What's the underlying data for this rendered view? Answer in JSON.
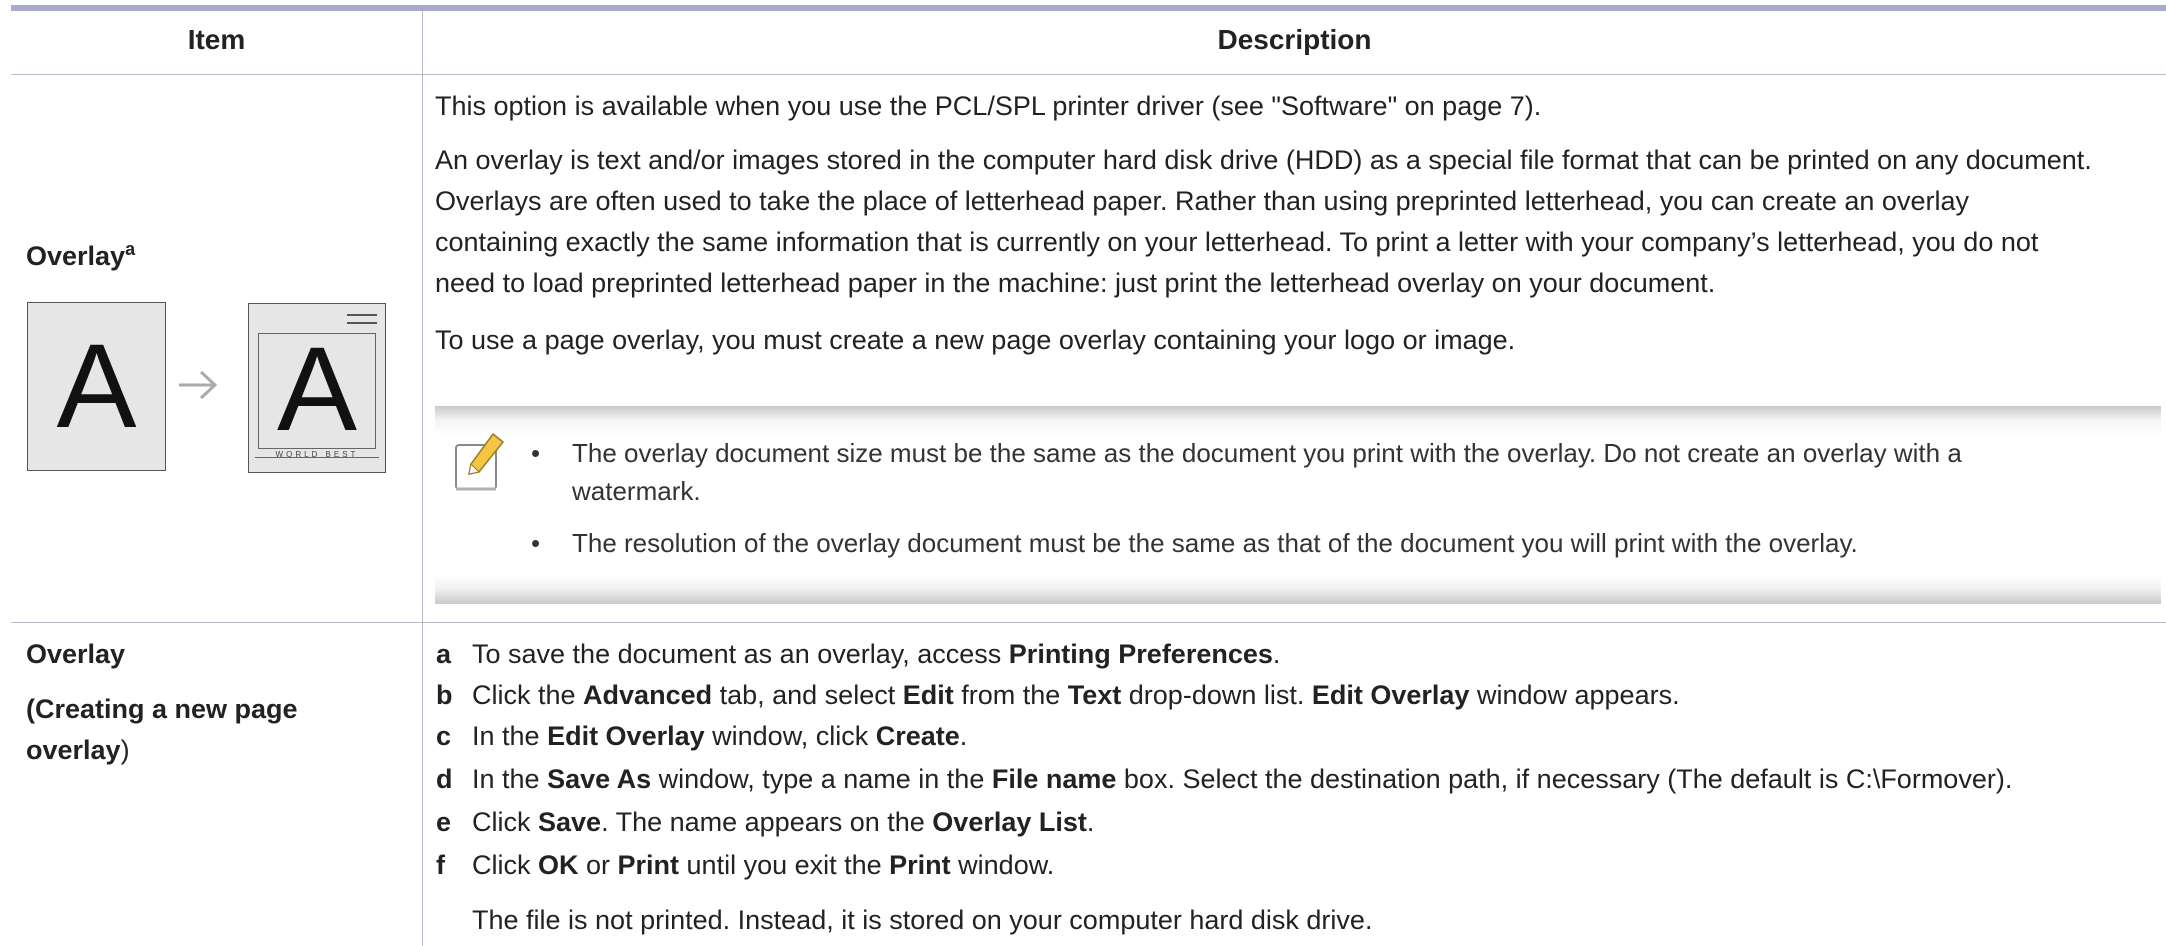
{
  "table": {
    "header": {
      "item": "Item",
      "description": "Description"
    },
    "row1": {
      "item_label": "Overlay",
      "item_sup": "a",
      "figure": {
        "left_letter": "A",
        "right_letter": "A",
        "footer_text": "WORLD BEST"
      },
      "para1": "This option is available when you use the PCL/SPL printer driver (see \"Software\" on page 7).",
      "para2_lines": [
        "An overlay is text and/or images stored in the computer hard disk drive (HDD) as a special file format that can be printed on any document.",
        "Overlays are often used to take the place of letterhead paper. Rather than using preprinted letterhead, you can create an overlay",
        "containing exactly the same information that is currently on your letterhead. To print a letter with your company’s letterhead, you do not",
        "need to load preprinted letterhead paper in the machine: just print the letterhead overlay on your document."
      ],
      "para3": "To use a page overlay, you must create a new page overlay containing your logo or image.",
      "note": {
        "icon": "note-pencil-icon",
        "bullets": [
          {
            "line1": "The overlay document size must be the same as the document you print with the overlay. Do not create an overlay with a",
            "line2": "watermark."
          },
          {
            "line1": "The resolution of the overlay document must be the same as that of the document you will print with the overlay.",
            "line2": ""
          }
        ]
      }
    },
    "row2": {
      "item_line1": "Overlay",
      "item_line2_bold": "(Creating a new page",
      "item_line3_bold": "overlay",
      "item_line3_tail": ")",
      "steps": [
        {
          "letter": "a",
          "parts": [
            {
              "t": "To save the document as an overlay, access ",
              "b": false
            },
            {
              "t": "Printing Preferences",
              "b": true
            },
            {
              "t": ".",
              "b": false
            }
          ]
        },
        {
          "letter": "b",
          "parts": [
            {
              "t": "Click the ",
              "b": false
            },
            {
              "t": "Advanced",
              "b": true
            },
            {
              "t": " tab, and select ",
              "b": false
            },
            {
              "t": "Edit",
              "b": true
            },
            {
              "t": " from the ",
              "b": false
            },
            {
              "t": "Text",
              "b": true
            },
            {
              "t": " drop-down list. ",
              "b": false
            },
            {
              "t": "Edit Overlay",
              "b": true
            },
            {
              "t": " window appears.",
              "b": false
            }
          ]
        },
        {
          "letter": "c",
          "parts": [
            {
              "t": "In the ",
              "b": false
            },
            {
              "t": "Edit Overlay",
              "b": true
            },
            {
              "t": " window, click ",
              "b": false
            },
            {
              "t": "Create",
              "b": true
            },
            {
              "t": ".",
              "b": false
            }
          ]
        },
        {
          "letter": "d",
          "parts": [
            {
              "t": "In the ",
              "b": false
            },
            {
              "t": "Save As",
              "b": true
            },
            {
              "t": " window, type a name in the ",
              "b": false
            },
            {
              "t": "File name",
              "b": true
            },
            {
              "t": " box. Select the destination path, if necessary (The default is C:\\Formover).",
              "b": false
            }
          ]
        },
        {
          "letter": "e",
          "parts": [
            {
              "t": "Click ",
              "b": false
            },
            {
              "t": "Save",
              "b": true
            },
            {
              "t": ". The name appears on the ",
              "b": false
            },
            {
              "t": "Overlay List",
              "b": true
            },
            {
              "t": ".",
              "b": false
            }
          ]
        },
        {
          "letter": "f",
          "parts": [
            {
              "t": "Click ",
              "b": false
            },
            {
              "t": "OK",
              "b": true
            },
            {
              "t": " or ",
              "b": false
            },
            {
              "t": "Print",
              "b": true
            },
            {
              "t": " until you exit the ",
              "b": false
            },
            {
              "t": "Print",
              "b": true
            },
            {
              "t": " window.",
              "b": false
            }
          ]
        }
      ],
      "final_note": "The file is not printed. Instead, it is stored on your computer hard disk drive."
    }
  }
}
